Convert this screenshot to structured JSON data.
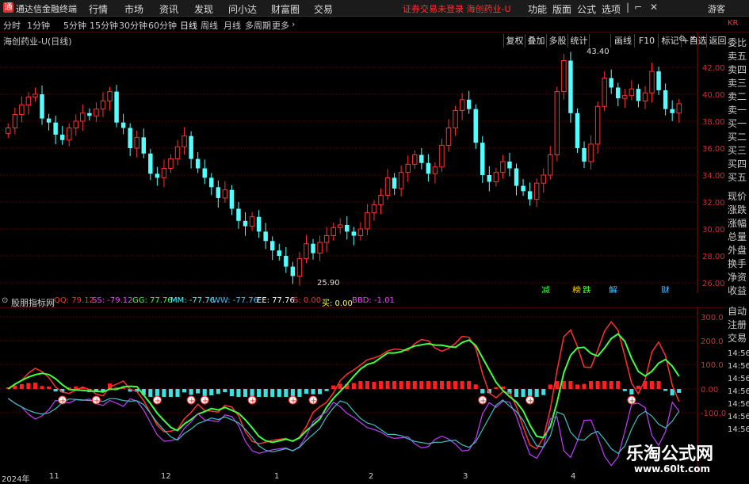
{
  "titlebar": {
    "app_name": "通达信金融终端",
    "menus": [
      "行情",
      "市场",
      "资讯",
      "发现",
      "问小达",
      "财富圈",
      "交易"
    ],
    "alert": "证券交易未登录  海创药业-U",
    "right_menus": [
      "功能",
      "版面",
      "公式",
      "选项"
    ],
    "guest": "游客"
  },
  "periods": [
    "分时",
    "1分钟",
    "5分钟",
    "15分钟",
    "30分钟",
    "60分钟",
    "日线",
    "周线",
    "月线",
    "多周期",
    "更多"
  ],
  "active_period": "日线",
  "tools": [
    "复权",
    "叠加",
    "多股",
    "统计",
    "画线",
    "F10",
    "标记",
    "+自选",
    "返回"
  ],
  "stock_title": "海创药业-U(日线)",
  "price_axis": {
    "labels": [
      "42.00",
      "40.00",
      "38.00",
      "36.00",
      "34.00",
      "32.00",
      "30.00",
      "28.00",
      "26.00"
    ],
    "max_label": "43.40",
    "min_label": "25.90"
  },
  "side_panel": {
    "top_tag": "KR",
    "items": [
      "委比",
      "卖五",
      "卖四",
      "卖三",
      "卖二",
      "卖一",
      "买一",
      "买二",
      "买三",
      "买四",
      "买五",
      "现价",
      "涨跌",
      "涨幅",
      "总量",
      "外盘",
      "换手",
      "净资",
      "收益"
    ],
    "lower_items": [
      "自动",
      "注册",
      "交易"
    ],
    "times": [
      "14:56",
      "14:56",
      "14:56",
      "14:56",
      "14:56",
      "14:56",
      "14:56"
    ]
  },
  "event_tags": [
    "减",
    "榜",
    "跌",
    "解",
    "财"
  ],
  "indicator": {
    "name": "股朋指标网",
    "values": [
      {
        "label": "QQ: 79.12",
        "color": "#ff3030"
      },
      {
        "label": "SS: -79.12",
        "color": "#ff40ff"
      },
      {
        "label": "GG: 77.76",
        "color": "#40ff40"
      },
      {
        "label": "MM: -77.76",
        "color": "#40ffff"
      },
      {
        "label": "WW: -77.76",
        "color": "#40c0ff"
      },
      {
        "label": "EE: 77.76",
        "color": "#ffffff"
      },
      {
        "label": "S: 0.00",
        "color": "#ff3030"
      },
      {
        "label": "买: 0.00",
        "color": "#ffff40"
      },
      {
        "label": "BBD: -1.01",
        "color": "#ff40ff"
      }
    ],
    "axis_labels": [
      "300.0",
      "200.0",
      "100.0",
      "0.00",
      "-100.0"
    ]
  },
  "dates": [
    "2024年",
    "11",
    "12",
    "1",
    "2",
    "3",
    "4"
  ],
  "watermark": {
    "cn": "乐淘公式网",
    "url": "www.60lt.com"
  },
  "colors": {
    "up": "#ff3030",
    "down": "#54ffff",
    "grid": "#5a0000",
    "axis": "#d03030"
  },
  "chart_data": {
    "type": "candlestick",
    "ylim": [
      25,
      44
    ],
    "close": [
      37.5,
      38.5,
      39.2,
      39.8,
      40.0,
      38.2,
      37.9,
      37.0,
      36.6,
      37.5,
      38.0,
      38.6,
      38.4,
      38.9,
      39.5,
      40.2,
      37.9,
      37.5,
      36.0,
      36.8,
      35.6,
      34.1,
      33.8,
      34.5,
      35.2,
      36.1,
      36.9,
      35.2,
      34.5,
      33.8,
      33.1,
      32.3,
      32.9,
      31.5,
      30.6,
      30.2,
      30.9,
      29.8,
      29.1,
      28.4,
      28.0,
      27.2,
      26.5,
      27.8,
      28.9,
      28.2,
      29.0,
      29.5,
      30.1,
      30.3,
      29.8,
      29.5,
      30.0,
      31.2,
      31.8,
      32.5,
      33.8,
      33.0,
      34.2,
      34.8,
      35.5,
      34.9,
      34.1,
      34.6,
      36.2,
      37.5,
      38.8,
      39.6,
      38.9,
      36.4,
      34.0,
      33.5,
      34.2,
      35.0,
      34.5,
      33.2,
      32.8,
      32.2,
      33.4,
      34.0,
      35.5,
      40.2,
      42.5,
      38.6,
      36.0,
      35.0,
      36.3,
      39.1,
      41.2,
      40.5,
      39.7,
      39.9,
      40.4,
      39.5,
      40.1,
      41.7,
      40.3,
      38.9,
      38.6,
      39.3
    ]
  }
}
